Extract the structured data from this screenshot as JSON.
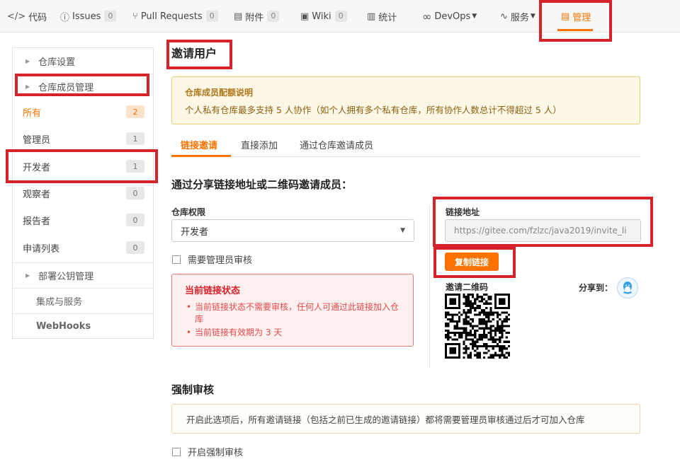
{
  "nav": {
    "tabs": [
      {
        "icon": "code-icon",
        "glyph": "</>",
        "label": "代码",
        "count": ""
      },
      {
        "icon": "issues-icon",
        "glyph": "ⓘ",
        "label": "Issues",
        "count": "0"
      },
      {
        "icon": "pull-request-icon",
        "glyph": "⑂",
        "label": "Pull Requests",
        "count": "0"
      },
      {
        "icon": "attachment-icon",
        "glyph": "▤",
        "label": "附件",
        "count": "0"
      },
      {
        "icon": "wiki-icon",
        "glyph": "▣",
        "label": "Wiki",
        "count": "0"
      },
      {
        "icon": "stats-icon",
        "glyph": "▥",
        "label": "统计",
        "count": ""
      },
      {
        "icon": "devops-icon",
        "glyph": "∞",
        "label": "DevOps",
        "count": ""
      },
      {
        "icon": "service-icon",
        "glyph": "∿",
        "label": "服务",
        "count": ""
      },
      {
        "icon": "manage-icon",
        "glyph": "▤",
        "label": "管理",
        "count": ""
      }
    ],
    "active_color": "#fe7300"
  },
  "sidebar": {
    "repo_settings": "仓库设置",
    "member_mgmt": "仓库成员管理",
    "items": [
      {
        "label": "所有",
        "count": "2"
      },
      {
        "label": "管理员",
        "count": "1"
      },
      {
        "label": "开发者",
        "count": "1"
      },
      {
        "label": "观察者",
        "count": "0"
      },
      {
        "label": "报告者",
        "count": "0"
      },
      {
        "label": "申请列表",
        "count": "0"
      }
    ],
    "deploy_keys": "部署公钥管理",
    "integrations": "集成与服务",
    "webhooks": "WebHooks"
  },
  "main": {
    "title": "邀请用户",
    "quota": {
      "title": "仓库成员配额说明",
      "text": "个人私有仓库最多支持 5 人协作（如个人拥有多个私有仓库，所有协作人数总计不得超过 5 人）"
    },
    "subtabs": [
      "链接邀请",
      "直接添加",
      "通过仓库邀请成员"
    ],
    "share_heading": "通过分享链接地址或二维码邀请成员：",
    "permission_label": "仓库权限",
    "permission_value": "开发者",
    "need_admin_review": "需要管理员审核",
    "status": {
      "title": "当前链接状态",
      "lines": [
        "当前链接状态不需要审核，任何人可通过此链接加入仓库",
        "当前链接有效期为 3 天"
      ]
    },
    "link_label": "链接地址",
    "link_value": "https://gitee.com/fzlzc/java2019/invite_li",
    "copy_button": "复制链接",
    "qr_label": "邀请二维码",
    "share_to": "分享到：",
    "force_review_heading": "强制审核",
    "force_review_notice": "开启此选项后，所有邀请链接（包括之前已生成的邀请链接）都将需要管理员审核通过后才可加入仓库",
    "force_review_checkbox": "开启强制审核"
  }
}
